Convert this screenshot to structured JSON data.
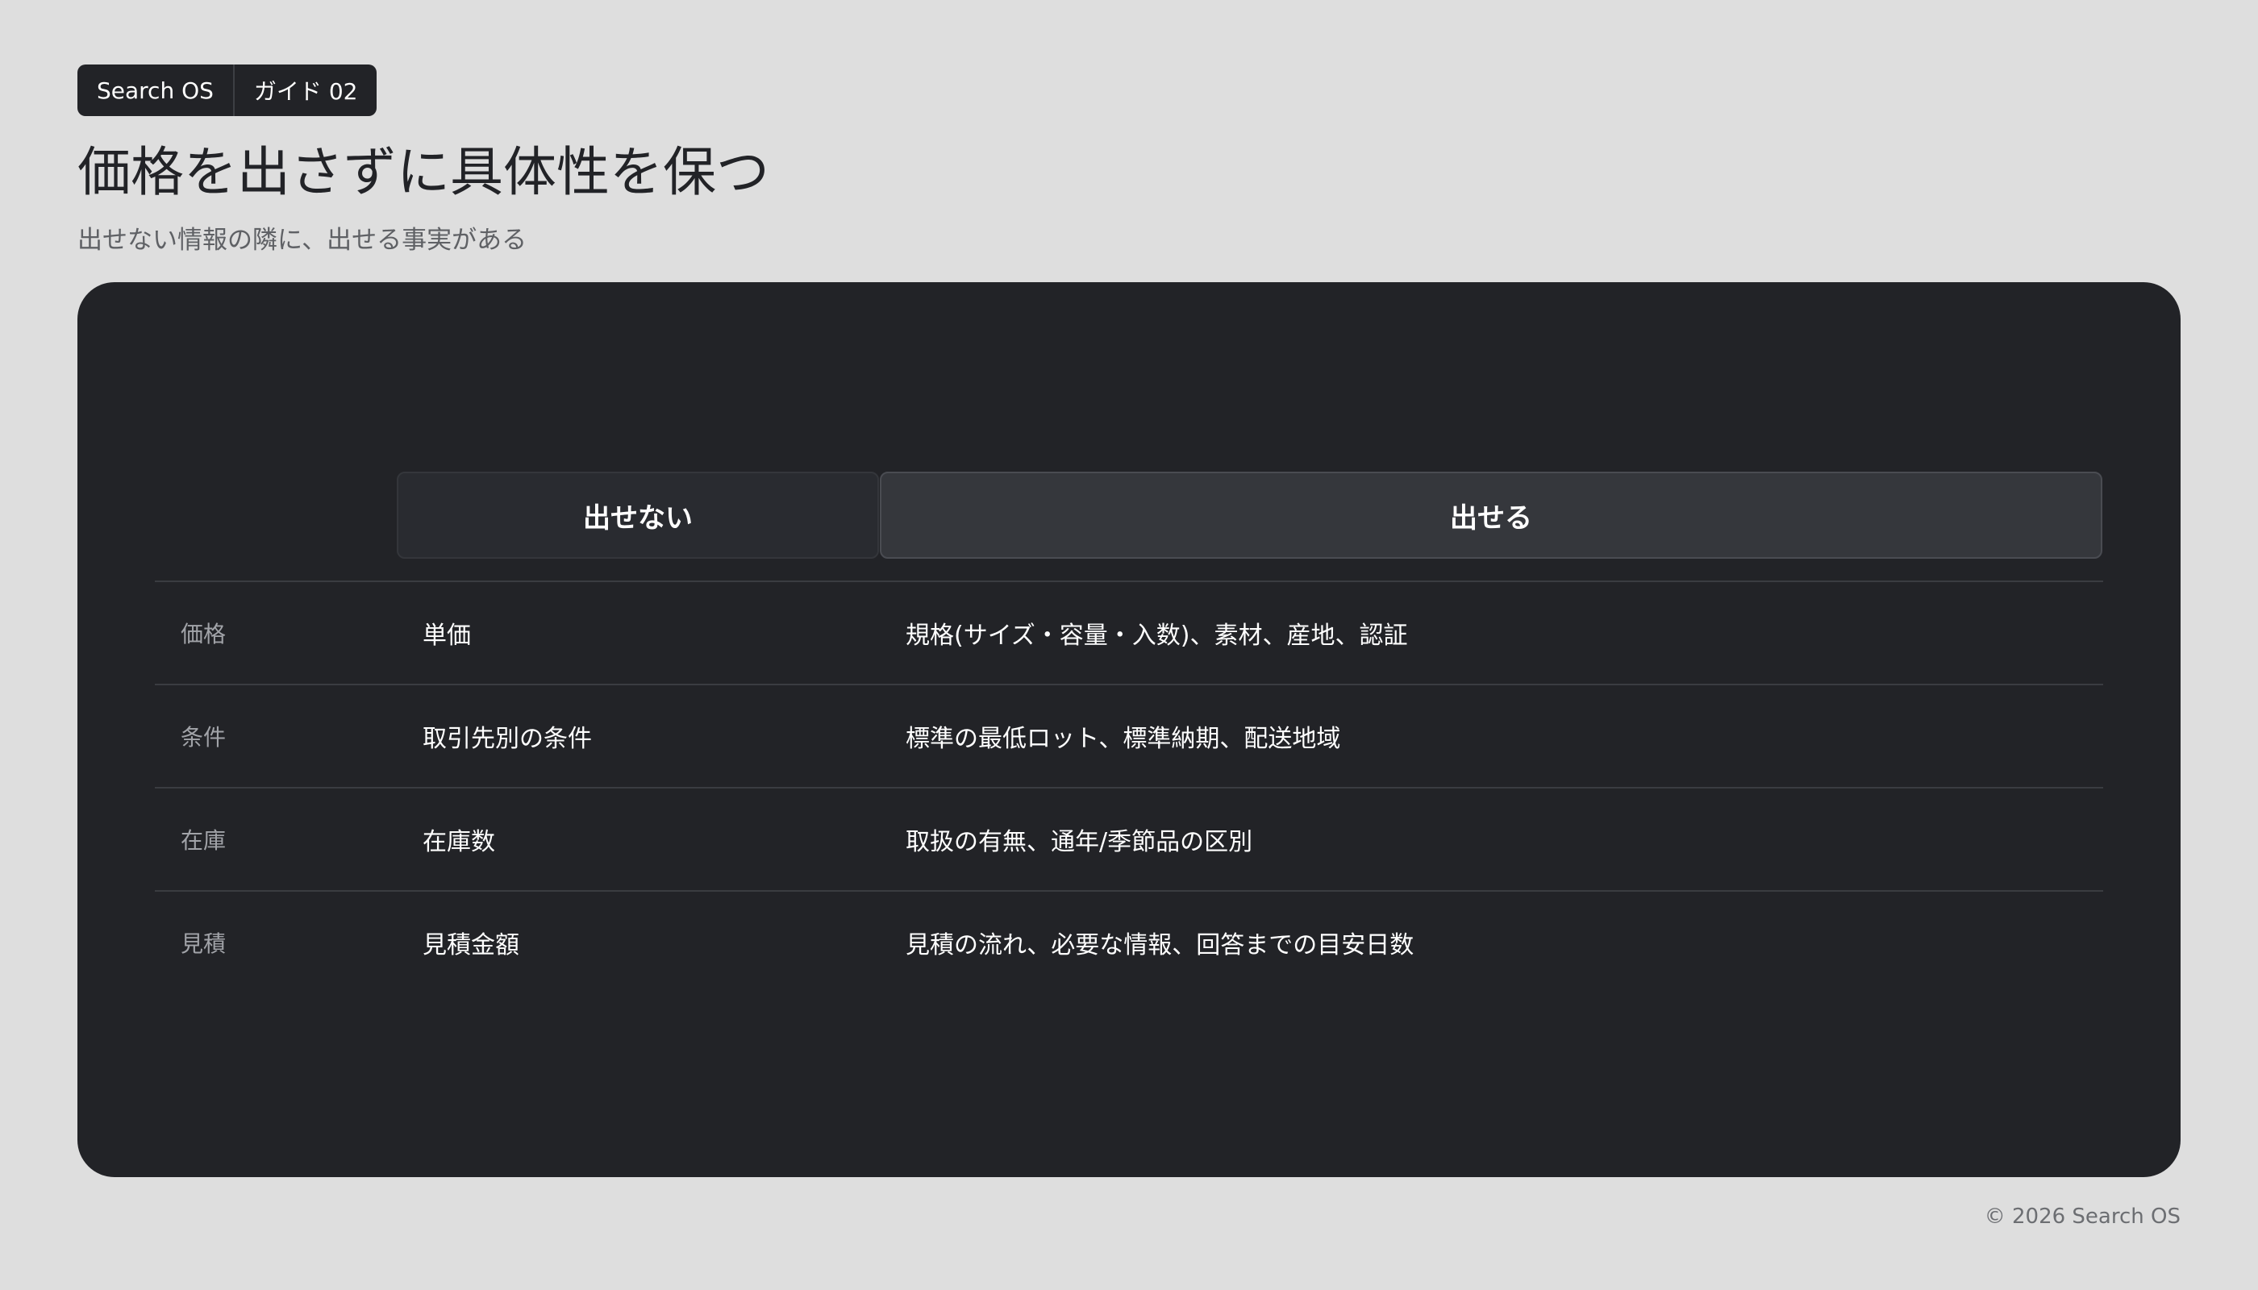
{
  "breadcrumb": {
    "items": [
      {
        "label": "Search OS"
      },
      {
        "label": "ガイド 02"
      }
    ]
  },
  "page": {
    "title": "価格を出さずに具体性を保つ",
    "subtitle": "出せない情報の隣に、出せる事実がある"
  },
  "table": {
    "columns": {
      "cannot": "出せない",
      "can": "出せる"
    },
    "rows": [
      {
        "label": "価格",
        "cannot": "単価",
        "can": "規格(サイズ・容量・入数)、素材、産地、認証"
      },
      {
        "label": "条件",
        "cannot": "取引先別の条件",
        "can": "標準の最低ロット、標準納期、配送地域"
      },
      {
        "label": "在庫",
        "cannot": "在庫数",
        "can": "取扱の有無、通年/季節品の区別"
      },
      {
        "label": "見積",
        "cannot": "見積金額",
        "can": "見積の流れ、必要な情報、回答までの目安日数"
      }
    ]
  },
  "footer": {
    "copyright": "© 2026 Search OS"
  },
  "colors": {
    "background": "#dedede",
    "panel": "#222327",
    "text_dark": "#222327",
    "text_light": "#ffffff",
    "text_muted": "#a1a3a8"
  }
}
